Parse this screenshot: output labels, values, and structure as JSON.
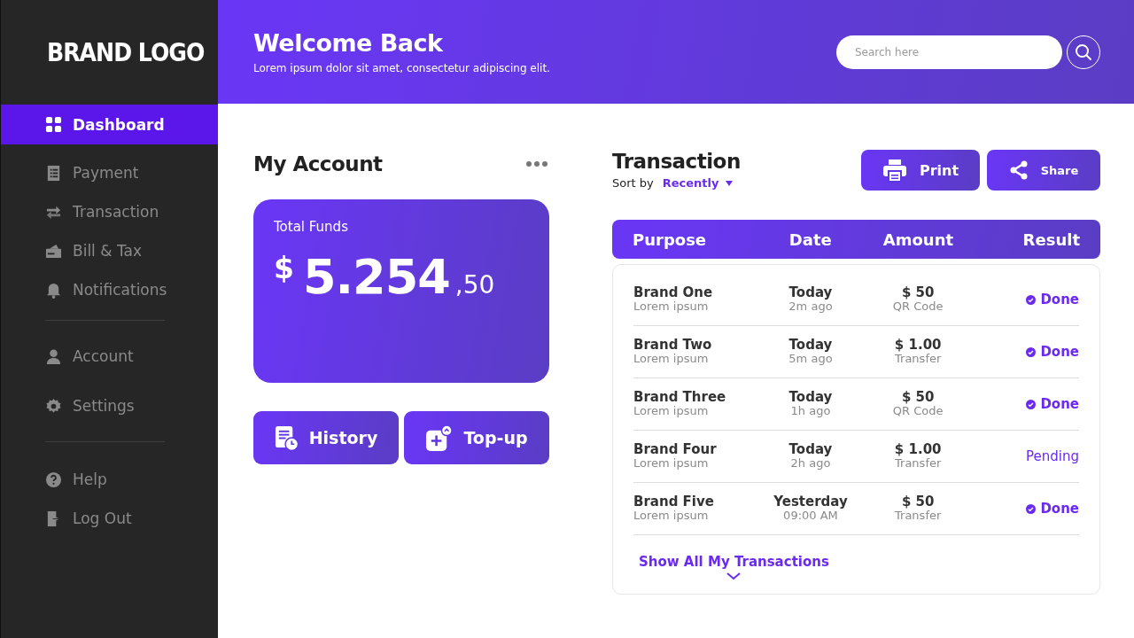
{
  "sidebar": {
    "logo": "BRAND LOGO",
    "groups": [
      [
        {
          "label": "Dashboard",
          "selected": true
        },
        {
          "label": "Payment",
          "selected": false
        },
        {
          "label": "Transaction",
          "selected": false
        },
        {
          "label": "Bill & Tax",
          "selected": false
        },
        {
          "label": "Notifications",
          "selected": false
        }
      ],
      [
        {
          "label": "Account",
          "selected": false
        },
        {
          "label": "Settings",
          "selected": false
        }
      ],
      [
        {
          "label": "Help",
          "selected": false
        },
        {
          "label": "Log Out",
          "selected": false
        }
      ]
    ]
  },
  "header": {
    "title": "Welcome Back",
    "subtitle": "Lorem ipsum dolor sit amet, consectetur adipiscing elit.",
    "search": {
      "placeholder": "Search here"
    }
  },
  "account": {
    "title": "My Account",
    "card": {
      "label": "Total Funds",
      "currency": "$",
      "amount": "5.254",
      "cents": ",50"
    },
    "buttons": [
      "History",
      "Top-up"
    ]
  },
  "transactions": {
    "title": "Transaction",
    "sort_label": "Sort by",
    "sort_value": "Recently",
    "buttons": [
      "Print",
      "Share"
    ],
    "columns": [
      "Purpose",
      "Date",
      "Amount",
      "Result"
    ],
    "rows": [
      {
        "purpose": "Brand One",
        "note": "Lorem ipsum",
        "date": "Today",
        "ago": "2m ago",
        "amount": "$ 50",
        "method": "QR Code",
        "result": "Done",
        "kind": "done"
      },
      {
        "purpose": "Brand Two",
        "note": "Lorem ipsum",
        "date": "Today",
        "ago": "5m ago",
        "amount": "$ 1.00",
        "method": "Transfer",
        "result": "Done",
        "kind": "done"
      },
      {
        "purpose": "Brand Three",
        "note": "Lorem ipsum",
        "date": "Today",
        "ago": "1h ago",
        "amount": "$ 50",
        "method": "QR Code",
        "result": "Done",
        "kind": "done"
      },
      {
        "purpose": "Brand Four",
        "note": "Lorem ipsum",
        "date": "Today",
        "ago": "2h ago",
        "amount": "$ 1.00",
        "method": "Transfer",
        "result": "Pending",
        "kind": "pending"
      },
      {
        "purpose": "Brand Five",
        "note": "Lorem ipsum",
        "date": "Yesterday",
        "ago": "09:00 AM",
        "amount": "$ 50",
        "method": "Transfer",
        "result": "Done",
        "kind": "done"
      }
    ],
    "show_all": "Show All My Transactions"
  }
}
